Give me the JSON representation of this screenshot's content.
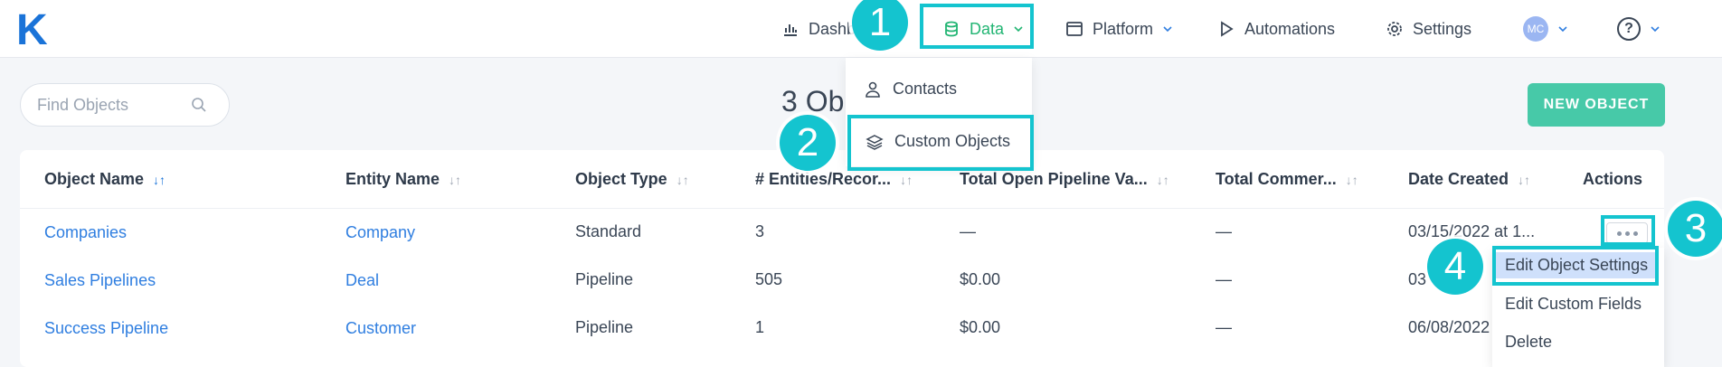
{
  "logo": "K",
  "nav": {
    "dashboard": "Dashb",
    "data": "Data",
    "platform": "Platform",
    "automations": "Automations",
    "settings": "Settings",
    "avatar_initials": "MC",
    "help": "?"
  },
  "data_menu": {
    "contacts": "Contacts",
    "custom_objects": "Custom Objects"
  },
  "search": {
    "placeholder": "Find Objects"
  },
  "page_title": "3 Ob",
  "new_object_label": "NEW OBJECT",
  "table": {
    "headers": [
      "Object Name",
      "Entity Name",
      "Object Type",
      "# Entities/Recor...",
      "Total Open Pipeline Va...",
      "Total Commer...",
      "Date Created",
      "Actions"
    ],
    "rows": [
      [
        "Companies",
        "Company",
        "Standard",
        "3",
        "—",
        "—",
        "03/15/2022 at 1..."
      ],
      [
        "Sales Pipelines",
        "Deal",
        "Pipeline",
        "505",
        "$0.00",
        "—",
        "03"
      ],
      [
        "Success Pipeline",
        "Customer",
        "Pipeline",
        "1",
        "$0.00",
        "—",
        "06/08/2022"
      ]
    ]
  },
  "actions_menu": {
    "edit_settings": "Edit Object Settings",
    "edit_fields": "Edit Custom Fields",
    "delete": "Delete"
  },
  "callouts": [
    "1",
    "2",
    "3",
    "4"
  ],
  "colors": {
    "brand": "#1a73d8",
    "accent_green": "#22b573",
    "new_button": "#47c9a8",
    "highlight": "#14c4cf",
    "link": "#2f7ee0"
  }
}
